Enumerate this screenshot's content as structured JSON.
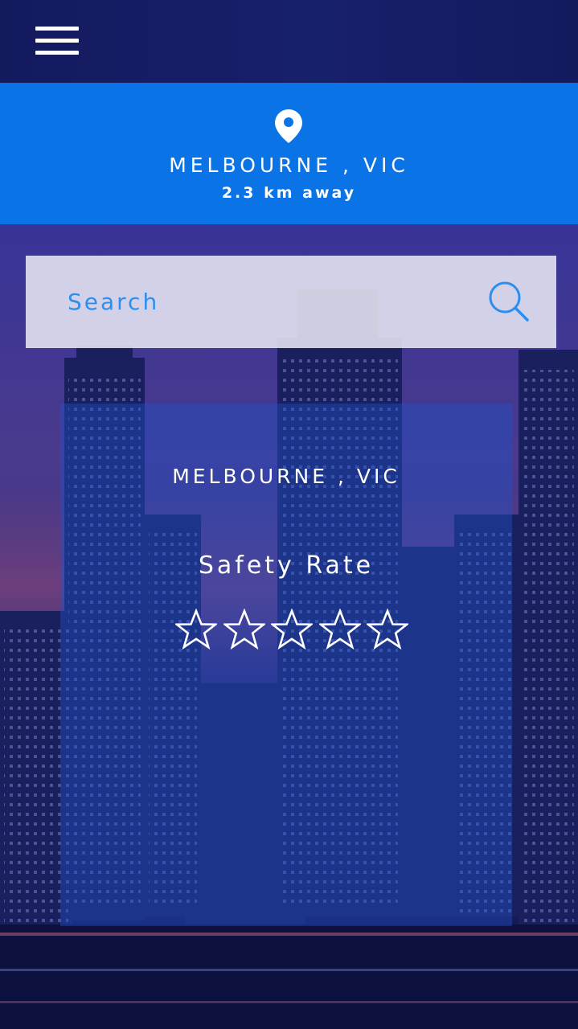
{
  "header": {
    "menu_icon": "hamburger-menu-icon"
  },
  "location": {
    "icon": "map-pin-icon",
    "name": "MELBOURNE , VIC",
    "distance": "2.3 km away"
  },
  "search": {
    "placeholder": "Search",
    "icon": "search-icon"
  },
  "card": {
    "city": "MELBOURNE , VIC",
    "rating_label": "Safety Rate",
    "rating_value": 0,
    "rating_max": 5
  },
  "colors": {
    "topbar": "#17206a",
    "banner": "#0a74e6",
    "search_text": "#2c8ff0",
    "card_overlay": "#1e50c8"
  }
}
